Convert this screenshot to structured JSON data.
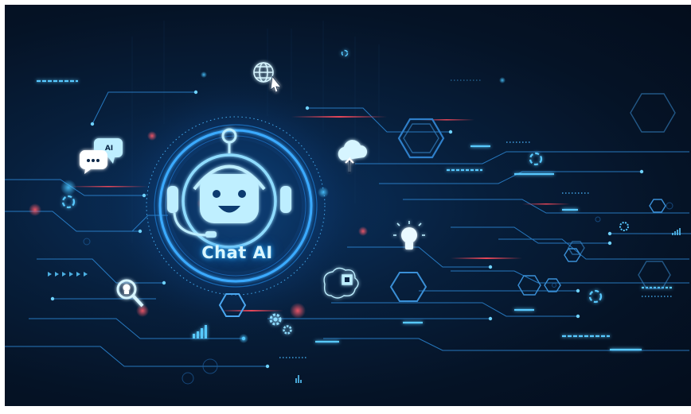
{
  "illustration": {
    "title": "Chat AI",
    "bubble_badge": "AI"
  },
  "icons": [
    "robot-head-icon",
    "headset-icon",
    "chat-bubbles-icon",
    "globe-cursor-icon",
    "cloud-upload-icon",
    "lightbulb-icon",
    "magnifier-lightbulb-icon",
    "brain-chip-icon",
    "gears-icon",
    "bar-chart-icon",
    "loading-ring-icon",
    "hexagon-icon",
    "chevron-arrows-icon"
  ],
  "colors": {
    "background_dark": "#040d1c",
    "background_glow": "#0b3566",
    "neon_blue": "#2fb4ff",
    "cyan_light": "#bdeeff",
    "accent_red": "#ff4b5c"
  }
}
